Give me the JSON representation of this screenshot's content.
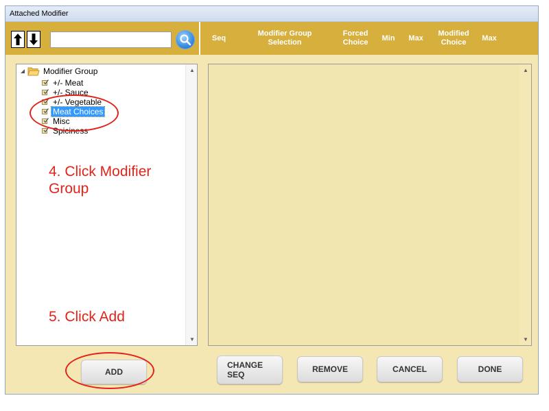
{
  "window": {
    "title": "Attached Modifier"
  },
  "toolbar": {
    "search_value": "",
    "up_icon": "arrow-up-icon",
    "down_icon": "arrow-down-icon",
    "search_icon": "magnifier-icon"
  },
  "columns": [
    {
      "label": "Seq"
    },
    {
      "label": "Modifier Group\nSelection"
    },
    {
      "label": "Forced\nChoice"
    },
    {
      "label": "Min"
    },
    {
      "label": "Max"
    },
    {
      "label": "Modified\nChoice"
    },
    {
      "label": "Max"
    }
  ],
  "tree": {
    "root": {
      "label": "Modifier Group",
      "icon": "folder-icon"
    },
    "items": [
      {
        "label": "+/- Meat",
        "selected": false
      },
      {
        "label": "+/- Sauce",
        "selected": false
      },
      {
        "label": "+/- Vegetable",
        "selected": false
      },
      {
        "label": "Meat Choices",
        "selected": true
      },
      {
        "label": "Misc",
        "selected": false
      },
      {
        "label": "Spiciness",
        "selected": false
      }
    ]
  },
  "annotations": {
    "step4": "4. Click Modifier\nGroup",
    "step5": "5. Click Add",
    "color": "#e2231a"
  },
  "buttons": {
    "add": "ADD",
    "change_seq": "CHANGE\nSEQ",
    "remove": "REMOVE",
    "cancel": "CANCEL",
    "done": "DONE"
  },
  "colors": {
    "header": "#d6af3c",
    "panel": "#f5e7b3",
    "selection": "#3399ff"
  }
}
